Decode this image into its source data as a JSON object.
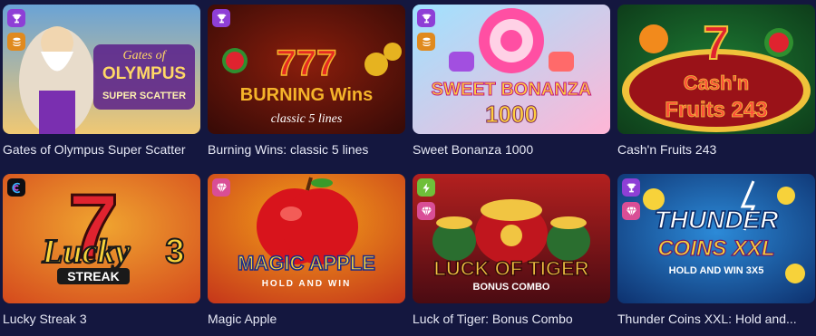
{
  "games": [
    {
      "title": "Gates of Olympus Super Scatter",
      "art_text": [
        "Gates of",
        "OLYMPUS",
        "SUPER SCATTER"
      ],
      "badges": [
        "trophy-icon",
        "coin-stack-icon"
      ],
      "colors": {
        "bg1": "#6aa3d6",
        "bg2": "#f0c873",
        "accent": "#7a2fb0"
      }
    },
    {
      "title": "Burning Wins: classic 5 lines",
      "art_text": [
        "777",
        "BURNING Wins",
        "classic 5 lines"
      ],
      "badges": [
        "trophy-icon"
      ],
      "colors": {
        "bg1": "#3a0b07",
        "bg2": "#8a1e0c",
        "accent": "#f5b42a"
      }
    },
    {
      "title": "Sweet Bonanza 1000",
      "art_text": [
        "SWEET BONANZA",
        "1000"
      ],
      "badges": [
        "trophy-icon",
        "coin-stack-icon"
      ],
      "colors": {
        "bg1": "#ffb6d6",
        "bg2": "#9fe2ff",
        "accent": "#ff4fa3"
      }
    },
    {
      "title": "Cash'n Fruits 243",
      "art_text": [
        "7",
        "Cash'n",
        "Fruits 243"
      ],
      "badges": [],
      "colors": {
        "bg1": "#0e3d1a",
        "bg2": "#1d7a33",
        "accent": "#e0232f"
      }
    },
    {
      "title": "Lucky Streak 3",
      "art_text": [
        "7",
        "Lucky",
        "3",
        "STREAK"
      ],
      "badges": [
        "provider-logo-icon"
      ],
      "colors": {
        "bg1": "#f0a530",
        "bg2": "#d4471c",
        "accent": "#e0232f"
      }
    },
    {
      "title": "Magic Apple",
      "art_text": [
        "MAGIC APPLE",
        "HOLD AND WIN"
      ],
      "badges": [
        "diamond-icon"
      ],
      "colors": {
        "bg1": "#f3a019",
        "bg2": "#c6381a",
        "accent": "#d8141c"
      }
    },
    {
      "title": "Luck of Tiger: Bonus Combo",
      "art_text": [
        "LUCK OF TIGER",
        "BONUS COMBO"
      ],
      "badges": [
        "bolt-icon",
        "diamond-icon"
      ],
      "colors": {
        "bg1": "#4a0b12",
        "bg2": "#b3201f",
        "accent": "#f1c542"
      }
    },
    {
      "title": "Thunder Coins XXL: Hold and...",
      "art_text": [
        "THUNDER",
        "COINS XXL",
        "HOLD AND WIN 3X5"
      ],
      "badges": [
        "trophy-icon",
        "diamond-icon"
      ],
      "colors": {
        "bg1": "#2c8ad8",
        "bg2": "#0b2a66",
        "accent": "#f7d23a"
      }
    }
  ]
}
